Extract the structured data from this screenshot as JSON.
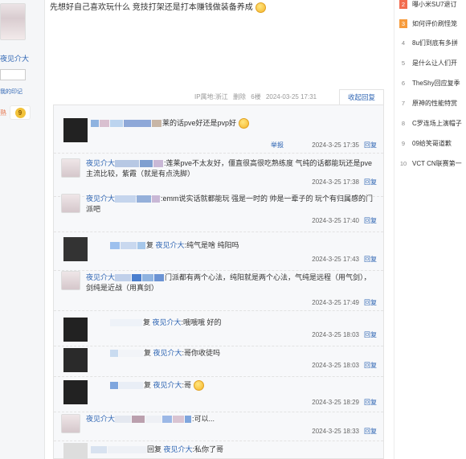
{
  "sidebar": {
    "username": "夜见介大",
    "link_text": "我的印记",
    "fire_text": "熟",
    "badge_level": "9"
  },
  "post": {
    "text": "先想好自己喜欢玩什么 竞技打架还是打本赚钱做装备养成",
    "ip": "IP属地:浙江",
    "delete": "删除",
    "floor": "6楼",
    "time": "2024-03-25 17:31",
    "collapse": "收起回复"
  },
  "replies": [
    {
      "user": "",
      "text": "莱的话pve好还是pvp好",
      "time": "2024-3-25 17:35",
      "reply": "回复",
      "report": "举报"
    },
    {
      "user": "夜见介大",
      "text": ":莲莱pve不太友好，僵直很高很吃熟练度 气纯的话都能玩还是pve主流比较，紫霞（就是有点洗脚）",
      "time": "2024-3-25 17:38",
      "reply": "回复"
    },
    {
      "user": "夜见介大",
      "text": ":emm说实话就都能玩 强是一时的 帅是一辈子的 玩个有归属感的门派吧",
      "time": "2024-3-25 17:40",
      "reply": "回复"
    },
    {
      "user": "",
      "prefix": "复",
      "target": "夜见介大",
      "text": ":纯气是啥 纯阳吗",
      "time": "2024-3-25 17:43",
      "reply": "回复"
    },
    {
      "user": "夜见介大",
      "text": "门派都有两个心法，纯阳就是两个心法，气纯是远程（用气剑），剑纯是近战（用真剑）",
      "time": "2024-3-25 17:49",
      "reply": "回复"
    },
    {
      "user": "",
      "prefix": "复",
      "target": "夜见介大",
      "text": ":哦哦哦 好的",
      "time": "2024-3-25 18:03",
      "reply": "回复"
    },
    {
      "user": "",
      "prefix": "复",
      "target": "夜见介大",
      "text": ":哥你收徒吗",
      "time": "2024-3-25 18:03",
      "reply": "回复"
    },
    {
      "user": "",
      "prefix": "复",
      "target": "夜见介大",
      "text": ":哥",
      "time": "2024-3-25 18:29",
      "reply": "回复"
    },
    {
      "user": "夜见介大",
      "text": ":可以...",
      "time": "2024-3-25 18:33",
      "reply": "回复"
    },
    {
      "user": "",
      "prefix": "回复",
      "target": "夜见介大",
      "text": ":私你了哥",
      "time": "",
      "reply": ""
    }
  ],
  "rank": [
    {
      "num": "2",
      "text": "曝小米SU7退订"
    },
    {
      "num": "3",
      "text": "如何评价刷怪笼"
    },
    {
      "num": "4",
      "text": "8u们到底有多拼"
    },
    {
      "num": "5",
      "text": "是什么让人们开"
    },
    {
      "num": "6",
      "text": "TheShy回应复季"
    },
    {
      "num": "7",
      "text": "原神的性能特赏"
    },
    {
      "num": "8",
      "text": "C罗连场上演帽子"
    },
    {
      "num": "9",
      "text": "09给笑哥道歉"
    },
    {
      "num": "10",
      "text": "VCT CN联赛第一"
    }
  ],
  "colors": {
    "link": "#2d64b3",
    "rank_hot": "#f26c4f",
    "rank_warm": "#f79b3c"
  }
}
